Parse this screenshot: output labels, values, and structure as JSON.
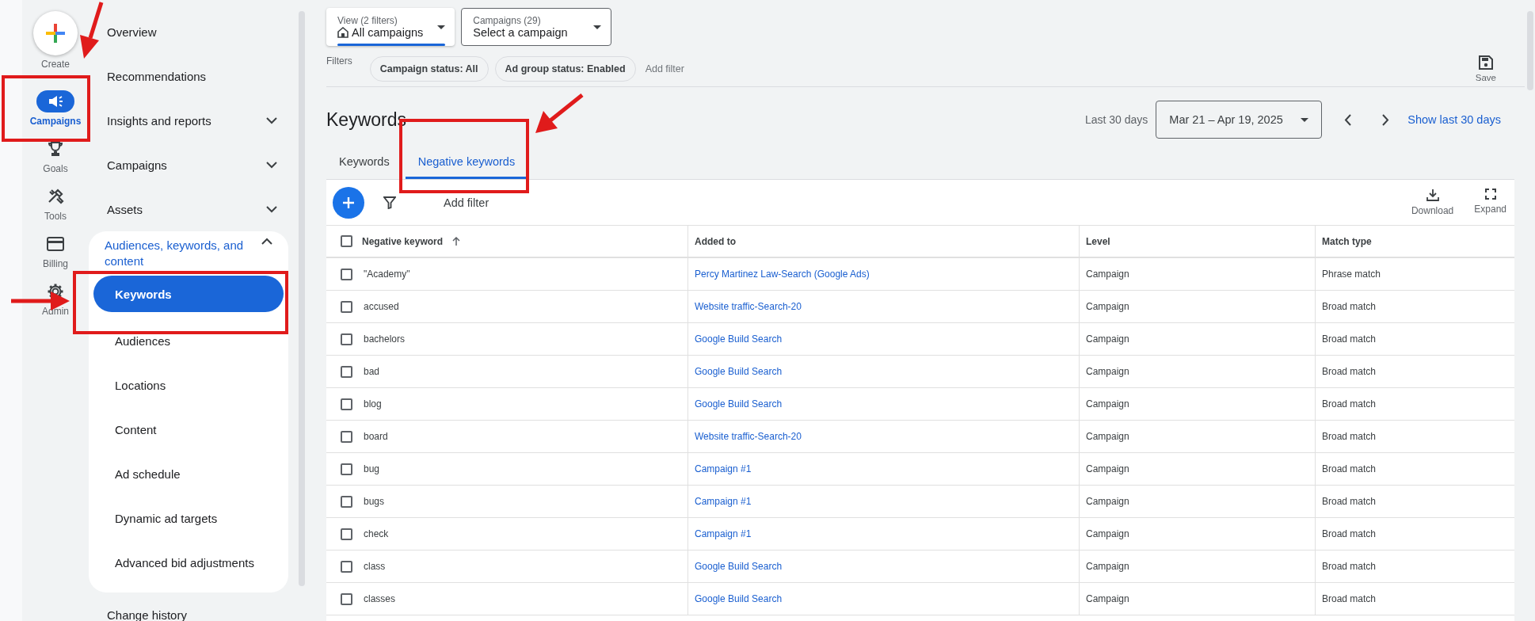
{
  "rail": {
    "create_label": "Create",
    "items": [
      {
        "label": "Campaigns",
        "selected": true
      },
      {
        "label": "Goals",
        "selected": false
      },
      {
        "label": "Tools",
        "selected": false
      },
      {
        "label": "Billing",
        "selected": false
      },
      {
        "label": "Admin",
        "selected": false
      }
    ]
  },
  "nav": {
    "items": [
      {
        "label": "Overview"
      },
      {
        "label": "Recommendations"
      },
      {
        "label": "Insights and reports",
        "expanded": false
      },
      {
        "label": "Campaigns",
        "expanded": false
      },
      {
        "label": "Assets",
        "expanded": false
      },
      {
        "label": "Audiences, keywords, and content",
        "expanded": true,
        "children": [
          {
            "label": "Keywords",
            "selected": true
          },
          {
            "label": "Audiences",
            "selected": false
          },
          {
            "label": "Locations",
            "selected": false
          },
          {
            "label": "Content",
            "selected": false
          },
          {
            "label": "Ad schedule",
            "selected": false
          },
          {
            "label": "Dynamic ad targets",
            "selected": false
          },
          {
            "label": "Advanced bid adjustments",
            "selected": false
          }
        ]
      },
      {
        "label": "Change history"
      }
    ]
  },
  "top": {
    "view_selector": {
      "caption": "View (2 filters)",
      "value": "All campaigns"
    },
    "campaign_selector": {
      "caption": "Campaigns (29)",
      "value": "Select a campaign"
    },
    "filters": {
      "label": "Filters",
      "chips": [
        "Campaign status: All",
        "Ad group status: Enabled"
      ],
      "add_filter": "Add filter"
    },
    "save_label": "Save"
  },
  "page_title": "Keywords",
  "date": {
    "label": "Last 30 days",
    "range": "Mar 21 – Apr 19, 2025",
    "show_last": "Show last 30 days"
  },
  "tabs": [
    {
      "label": "Keywords",
      "selected": false
    },
    {
      "label": "Negative keywords",
      "selected": true
    }
  ],
  "table": {
    "toolbar": {
      "add_filter": "Add filter",
      "download": "Download",
      "expand": "Expand"
    },
    "header_checked": false,
    "columns": [
      {
        "label": "Negative keyword",
        "sorted": true
      },
      {
        "label": "Added to",
        "sorted": false
      },
      {
        "label": "Level",
        "sorted": false
      },
      {
        "label": "Match type",
        "sorted": false
      }
    ],
    "rows": [
      {
        "keyword": "\"Academy\"",
        "added_to": "Percy Martinez Law-Search (Google Ads)",
        "level": "Campaign",
        "match_type": "Phrase match",
        "checked": false
      },
      {
        "keyword": "accused",
        "added_to": "Website traffic-Search-20",
        "level": "Campaign",
        "match_type": "Broad match",
        "checked": false
      },
      {
        "keyword": "bachelors",
        "added_to": "Google Build Search",
        "level": "Campaign",
        "match_type": "Broad match",
        "checked": false
      },
      {
        "keyword": "bad",
        "added_to": "Google Build Search",
        "level": "Campaign",
        "match_type": "Broad match",
        "checked": false
      },
      {
        "keyword": "blog",
        "added_to": "Google Build Search",
        "level": "Campaign",
        "match_type": "Broad match",
        "checked": false
      },
      {
        "keyword": "board",
        "added_to": "Website traffic-Search-20",
        "level": "Campaign",
        "match_type": "Broad match",
        "checked": false
      },
      {
        "keyword": "bug",
        "added_to": "Campaign #1",
        "level": "Campaign",
        "match_type": "Broad match",
        "checked": false
      },
      {
        "keyword": "bugs",
        "added_to": "Campaign #1",
        "level": "Campaign",
        "match_type": "Broad match",
        "checked": false
      },
      {
        "keyword": "check",
        "added_to": "Campaign #1",
        "level": "Campaign",
        "match_type": "Broad match",
        "checked": false
      },
      {
        "keyword": "class",
        "added_to": "Google Build Search",
        "level": "Campaign",
        "match_type": "Broad match",
        "checked": false
      },
      {
        "keyword": "classes",
        "added_to": "Google Build Search",
        "level": "Campaign",
        "match_type": "Broad match",
        "checked": false
      }
    ]
  }
}
